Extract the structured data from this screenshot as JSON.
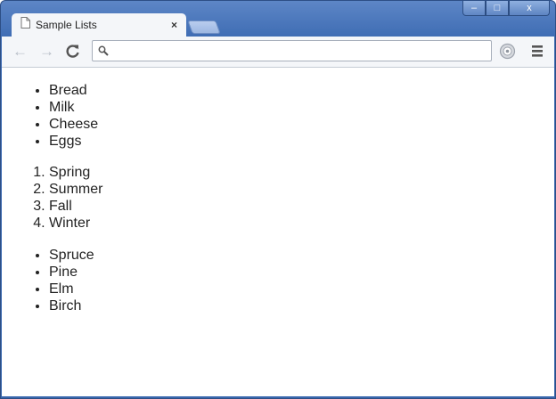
{
  "tab": {
    "title": "Sample Lists",
    "close": "×"
  },
  "window_controls": {
    "minimize": "–",
    "maximize": "□",
    "close": "x"
  },
  "toolbar": {
    "back": "←",
    "forward": "→",
    "reload": "C",
    "omnibox_value": "",
    "omnibox_placeholder": ""
  },
  "lists": {
    "groceries": [
      "Bread",
      "Milk",
      "Cheese",
      "Eggs"
    ],
    "seasons": [
      "Spring",
      "Summer",
      "Fall",
      "Winter"
    ],
    "trees": [
      "Spruce",
      "Pine",
      "Elm",
      "Birch"
    ]
  }
}
